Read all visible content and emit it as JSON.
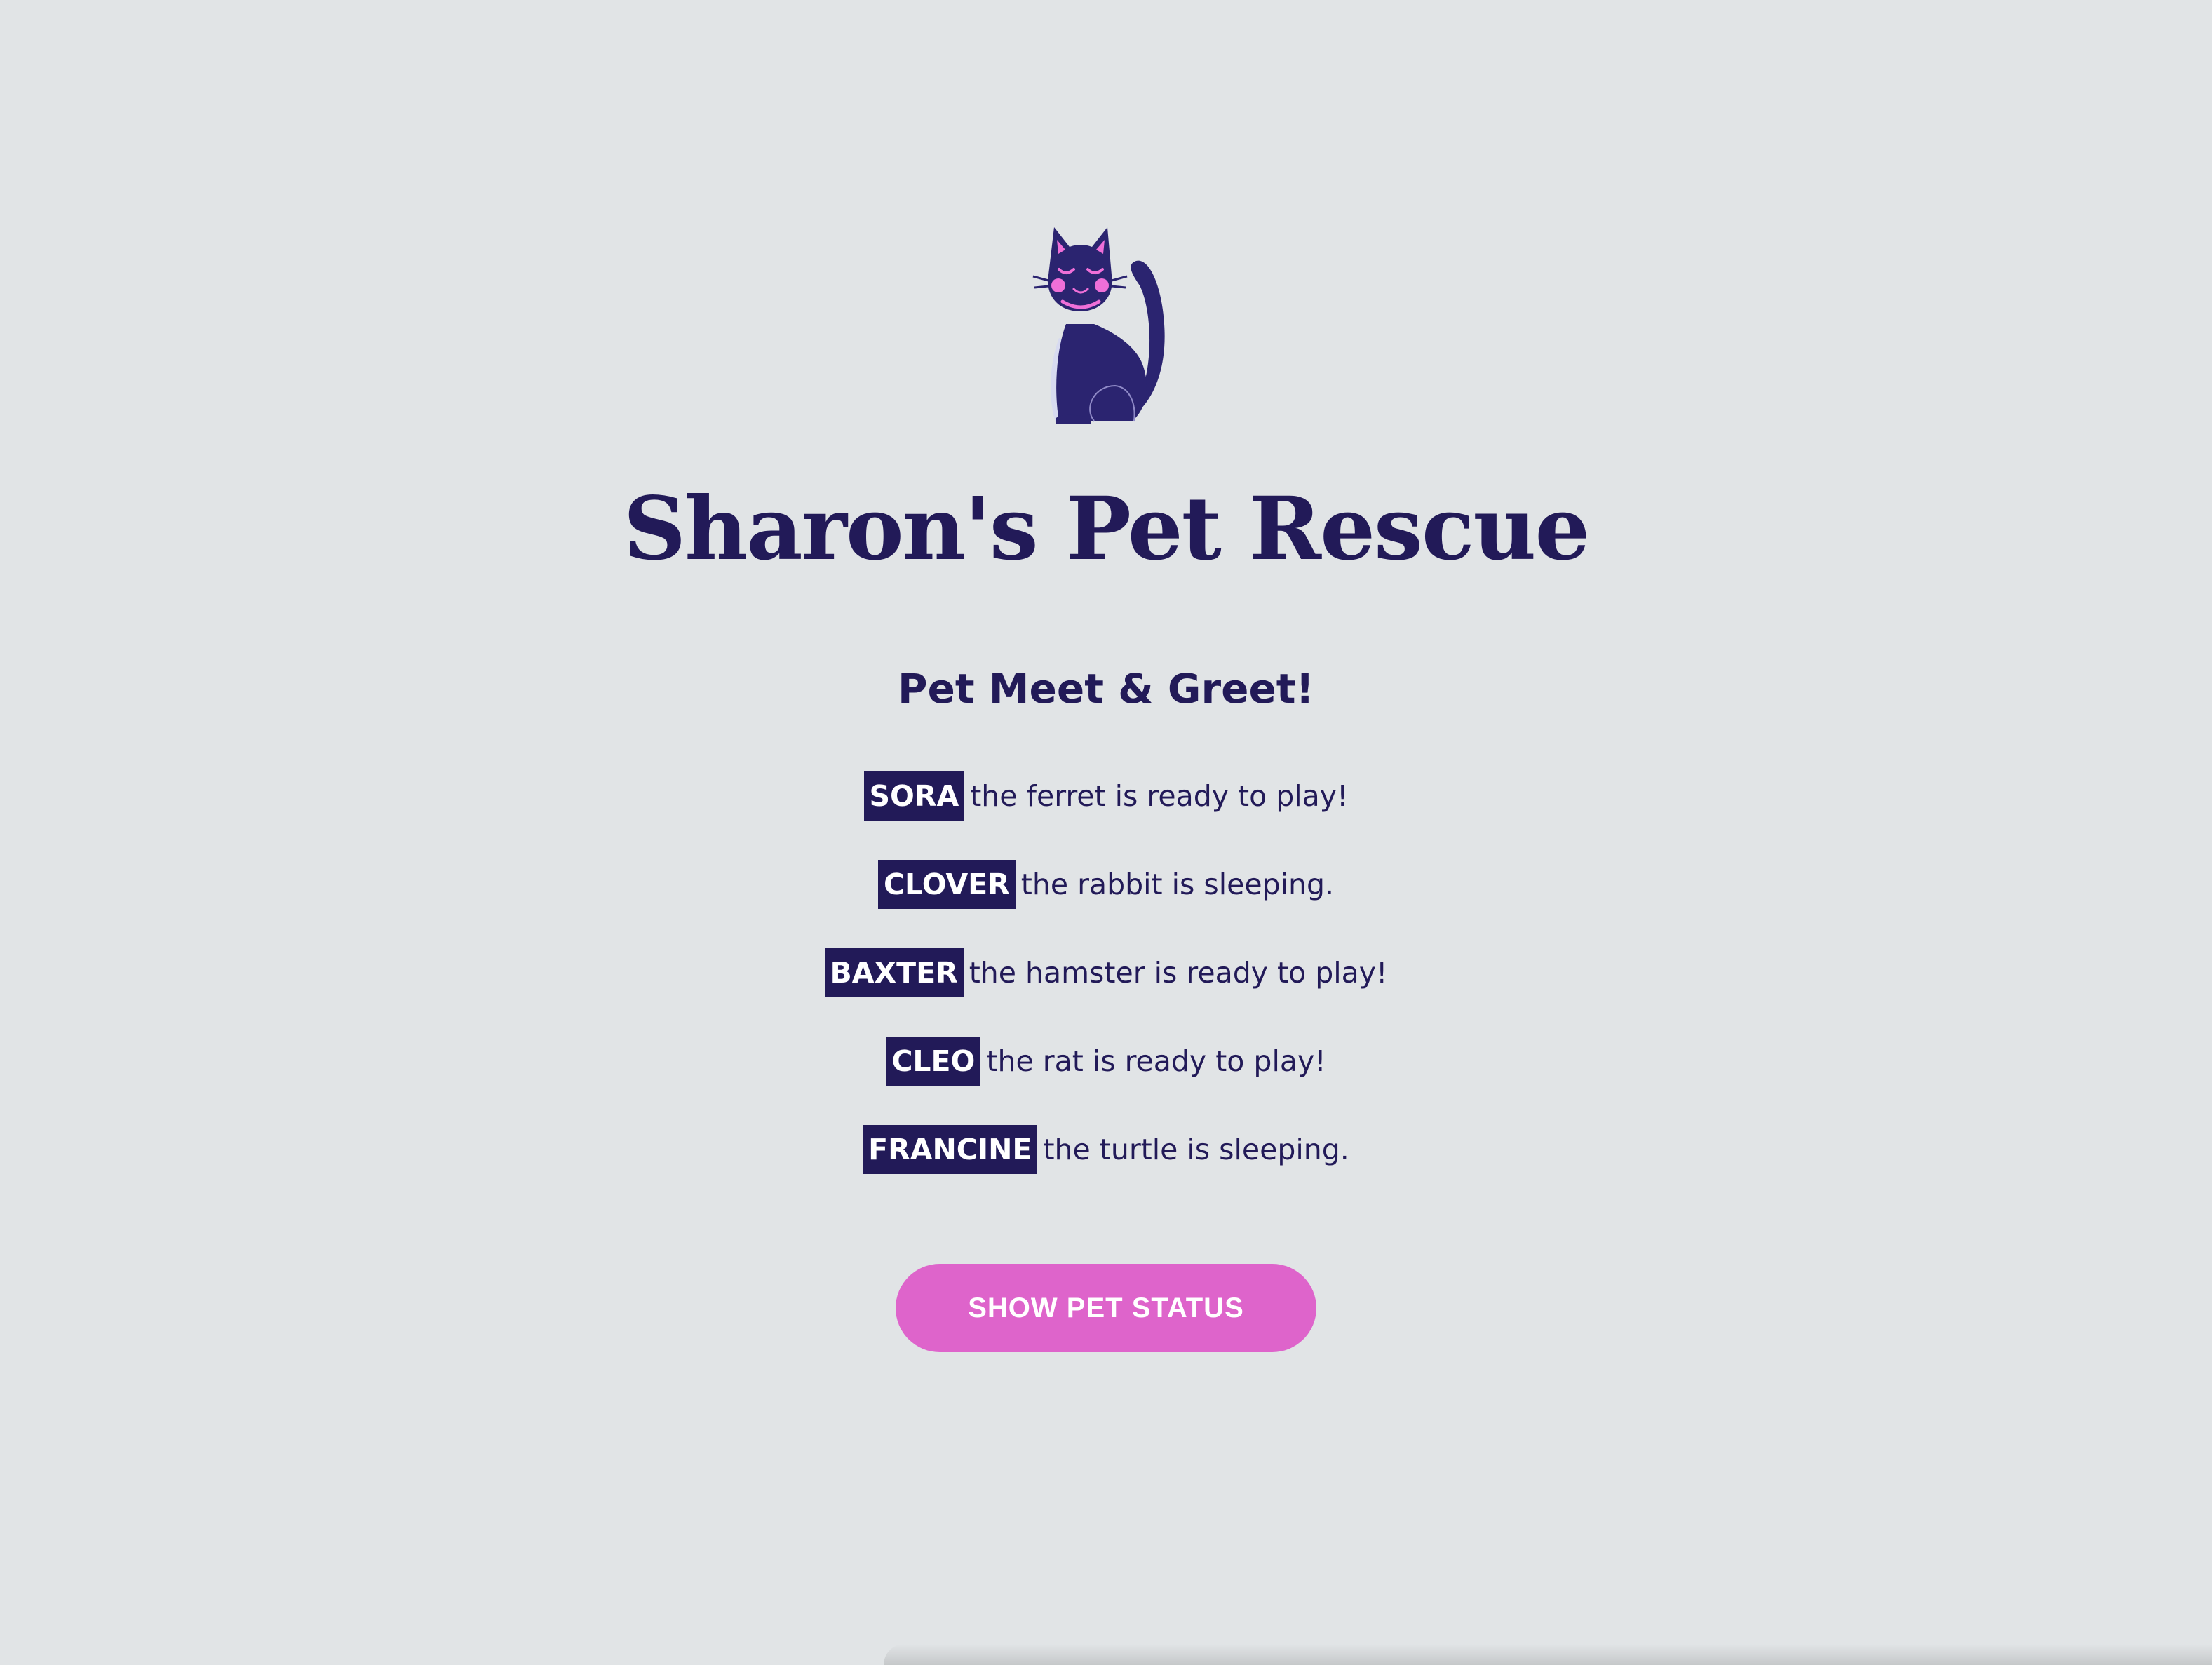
{
  "logo": {
    "icon": "cat-icon",
    "colors": {
      "body": "#2b2470",
      "accent": "#ef6fd8"
    }
  },
  "page_title": "Sharon's Pet Rescue",
  "section_title": "Pet Meet & Greet!",
  "pets": [
    {
      "name": "SORA",
      "description": "the ferret is ready to play!"
    },
    {
      "name": "CLOVER",
      "description": "the rabbit is sleeping."
    },
    {
      "name": "BAXTER",
      "description": "the hamster is ready to play!"
    },
    {
      "name": "CLEO",
      "description": "the rat is ready to play!"
    },
    {
      "name": "FRANCINE",
      "description": "the turtle is sleeping."
    }
  ],
  "status_button_label": "SHOW PET STATUS",
  "colors": {
    "background": "#e1e4e6",
    "text": "#221a58",
    "name_badge_bg": "#221a58",
    "button_bg": "#de64cb",
    "button_text": "#ffffff"
  }
}
